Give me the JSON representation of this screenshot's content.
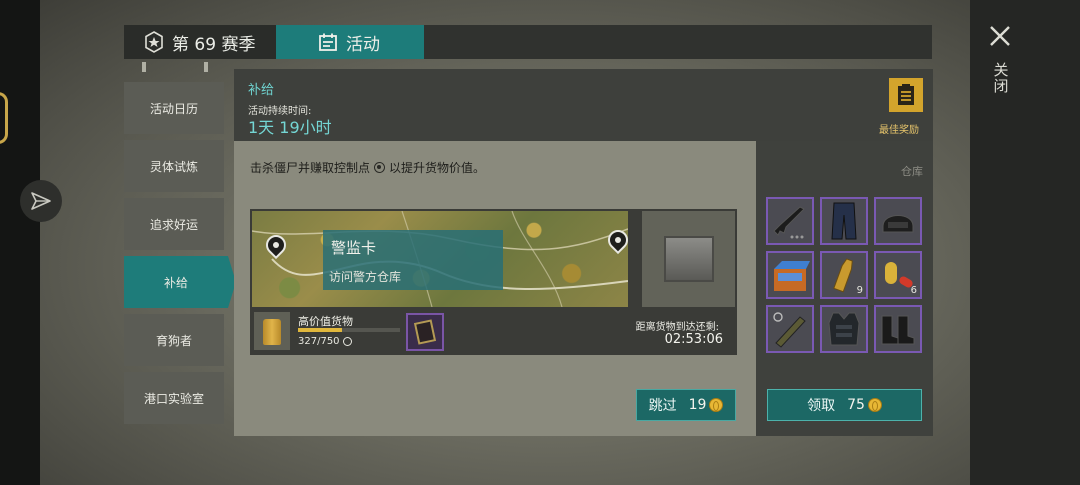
{
  "tabs": {
    "season_label": "第 69 赛季",
    "activity_label": "活动"
  },
  "sidebar": {
    "items": [
      {
        "label": "活动日历"
      },
      {
        "label": "灵体试炼"
      },
      {
        "label": "追求好运"
      },
      {
        "label": "补给",
        "active": true
      },
      {
        "label": "育狗者"
      },
      {
        "label": "港口实验室"
      }
    ]
  },
  "header": {
    "title": "补给",
    "duration_label": "活动持续时间:",
    "duration_value": "1天 19小时",
    "best_reward_label": "最佳奖励"
  },
  "content": {
    "description_before": "击杀僵尸并赚取控制点",
    "description_after": "以提升货物价值。",
    "location_name": "警监卡",
    "location_task": "访问警方仓库",
    "cargo_label": "高价值货物",
    "cargo_progress_text": "327/750",
    "cargo_progress_fraction": 0.436,
    "timer_label": "距离货物到达还剩:",
    "timer_value": "02:53:06",
    "skip_label": "跳过",
    "skip_cost": "19"
  },
  "warehouse": {
    "label": "仓库",
    "items": [
      {
        "icon": "rifle-icon",
        "count": ""
      },
      {
        "icon": "pants-icon",
        "count": ""
      },
      {
        "icon": "helmet-icon",
        "count": ""
      },
      {
        "icon": "blue-crate-icon",
        "count": ""
      },
      {
        "icon": "ammo-icon",
        "count": "9"
      },
      {
        "icon": "pill-icon",
        "count": "6"
      },
      {
        "icon": "launcher-icon",
        "count": ""
      },
      {
        "icon": "vest-icon",
        "count": ""
      },
      {
        "icon": "boots-icon",
        "count": ""
      }
    ],
    "claim_label": "领取",
    "claim_cost": "75"
  },
  "right_panel": {
    "close_label": "关闭"
  },
  "colors": {
    "accent_teal": "#1e7c7a",
    "gold": "#d3a42c",
    "rarity_purple": "#7a59b3"
  }
}
